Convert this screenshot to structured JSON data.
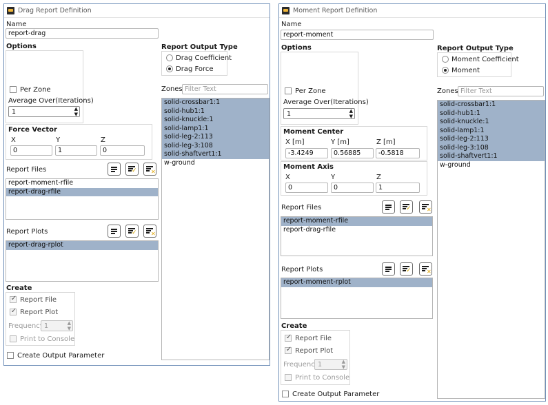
{
  "left": {
    "title": "Drag Report Definition",
    "name_label": "Name",
    "name_value": "report-drag",
    "options_label": "Options",
    "per_zone_label": "Per Zone",
    "avg_over_label": "Average Over(Iterations)",
    "avg_over_value": "1",
    "force_vector_label": "Force Vector",
    "fx_label": "X",
    "fy_label": "Y",
    "fz_label": "Z",
    "fx_value": "0",
    "fy_value": "1",
    "fz_value": "0",
    "report_files_label": "Report Files",
    "report_files": [
      "report-moment-rfile",
      "report-drag-rfile"
    ],
    "report_plots_label": "Report Plots",
    "report_plots": [
      "report-drag-rplot"
    ],
    "create_label": "Create",
    "report_file_label": "Report File",
    "report_plot_label": "Report Plot",
    "frequency_label": "Frequency",
    "frequency_value": "1",
    "print_console_label": "Print to Console",
    "create_output_label": "Create Output Parameter",
    "rot_label": "Report Output Type",
    "rot_options": [
      "Drag Coefficient",
      "Drag Force"
    ],
    "rot_selected": "Drag Force",
    "zones_label": "Zones",
    "zones_filter_placeholder": "Filter Text",
    "zones": [
      "solid-crossbar1:1",
      "solid-hub1:1",
      "solid-knuckle:1",
      "solid-lamp1:1",
      "solid-leg-2:113",
      "solid-leg-3:108",
      "solid-shaftvert1:1",
      "w-ground"
    ]
  },
  "right": {
    "title": "Moment Report Definition",
    "name_label": "Name",
    "name_value": "report-moment",
    "options_label": "Options",
    "per_zone_label": "Per Zone",
    "avg_over_label": "Average Over(Iterations)",
    "avg_over_value": "1",
    "moment_center_label": "Moment Center",
    "mcx_label": "X [m]",
    "mcy_label": "Y [m]",
    "mcz_label": "Z [m]",
    "mcx_value": "-3.4249",
    "mcy_value": "0.56885",
    "mcz_value": "-0.5818",
    "moment_axis_label": "Moment Axis",
    "max_label": "X",
    "may_label": "Y",
    "maz_label": "Z",
    "max_value": "0",
    "may_value": "0",
    "maz_value": "1",
    "report_files_label": "Report Files",
    "report_files": [
      "report-moment-rfile",
      "report-drag-rfile"
    ],
    "report_plots_label": "Report Plots",
    "report_plots": [
      "report-moment-rplot"
    ],
    "create_label": "Create",
    "report_file_label": "Report File",
    "report_plot_label": "Report Plot",
    "frequency_label": "Frequency",
    "frequency_value": "1",
    "print_console_label": "Print to Console",
    "create_output_label": "Create Output Parameter",
    "rot_label": "Report Output Type",
    "rot_options": [
      "Moment Coefficient",
      "Moment"
    ],
    "rot_selected": "Moment",
    "zones_label": "Zones",
    "zones_filter_placeholder": "Filter Text",
    "zones": [
      "solid-crossbar1:1",
      "solid-hub1:1",
      "solid-knuckle:1",
      "solid-lamp1:1",
      "solid-leg-2:113",
      "solid-leg-3:108",
      "solid-shaftvert1:1",
      "w-ground"
    ]
  }
}
